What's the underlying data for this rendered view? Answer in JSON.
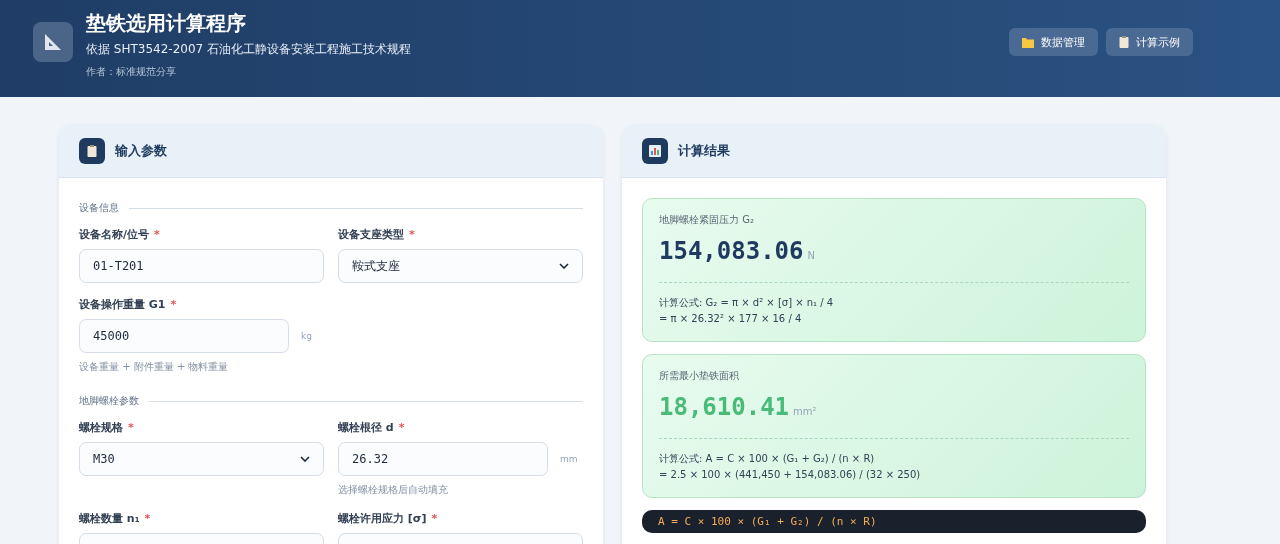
{
  "header": {
    "title": "垫铁选用计算程序",
    "subtitle": "依据 SHT3542-2007 石油化工静设备安装工程施工技术规程",
    "author": "作者：标准规范分享",
    "buttons": [
      {
        "label": "数据管理"
      },
      {
        "label": "计算示例"
      }
    ]
  },
  "input_panel": {
    "title": "输入参数",
    "sections": [
      {
        "title": "设备信息",
        "fields": [
          {
            "label": "设备名称/位号",
            "required": "*",
            "kind": "text",
            "value": "01-T201"
          },
          {
            "label": "设备支座类型",
            "required": "*",
            "kind": "select",
            "value": "鞍式支座"
          },
          {
            "label": "设备操作重量 G1",
            "required": "*",
            "kind": "text",
            "value": "45000",
            "unit": "kg",
            "hint": "设备重量 + 附件重量 + 物料重量"
          }
        ]
      },
      {
        "title": "地脚螺栓参数",
        "fields": [
          {
            "label": "螺栓规格",
            "required": "*",
            "kind": "select",
            "value": "M30"
          },
          {
            "label": "螺栓根径 d",
            "required": "*",
            "kind": "text",
            "value": "26.32",
            "unit": "mm",
            "hint": "选择螺栓规格后自动填充"
          },
          {
            "label": "螺栓数量 n₁",
            "required": "*",
            "kind": "text"
          },
          {
            "label": "螺栓许用应力 [σ]",
            "required": "*",
            "kind": "text"
          }
        ]
      }
    ]
  },
  "result_panel": {
    "title": "计算结果",
    "results": [
      {
        "label": "地脚螺栓紧固压力 G₂",
        "value": "154,083.06",
        "unit": "N",
        "formula": [
          "计算公式: G₂ = π × d² × [σ] × n₁ / 4",
          "= π × 26.32² × 177 × 16 / 4"
        ]
      },
      {
        "label": "所需最小垫铁面积",
        "value": "18,610.41",
        "unit": "mm²",
        "formula": [
          "计算公式: A = C × 100 × (G₁ + G₂) / (n × R)",
          "= 2.5 × 100 × (441,450 + 154,083.06) / (32 × 250)"
        ]
      }
    ],
    "code": "A = C × 100 × (G₁ + G₂) / (n × R)"
  }
}
